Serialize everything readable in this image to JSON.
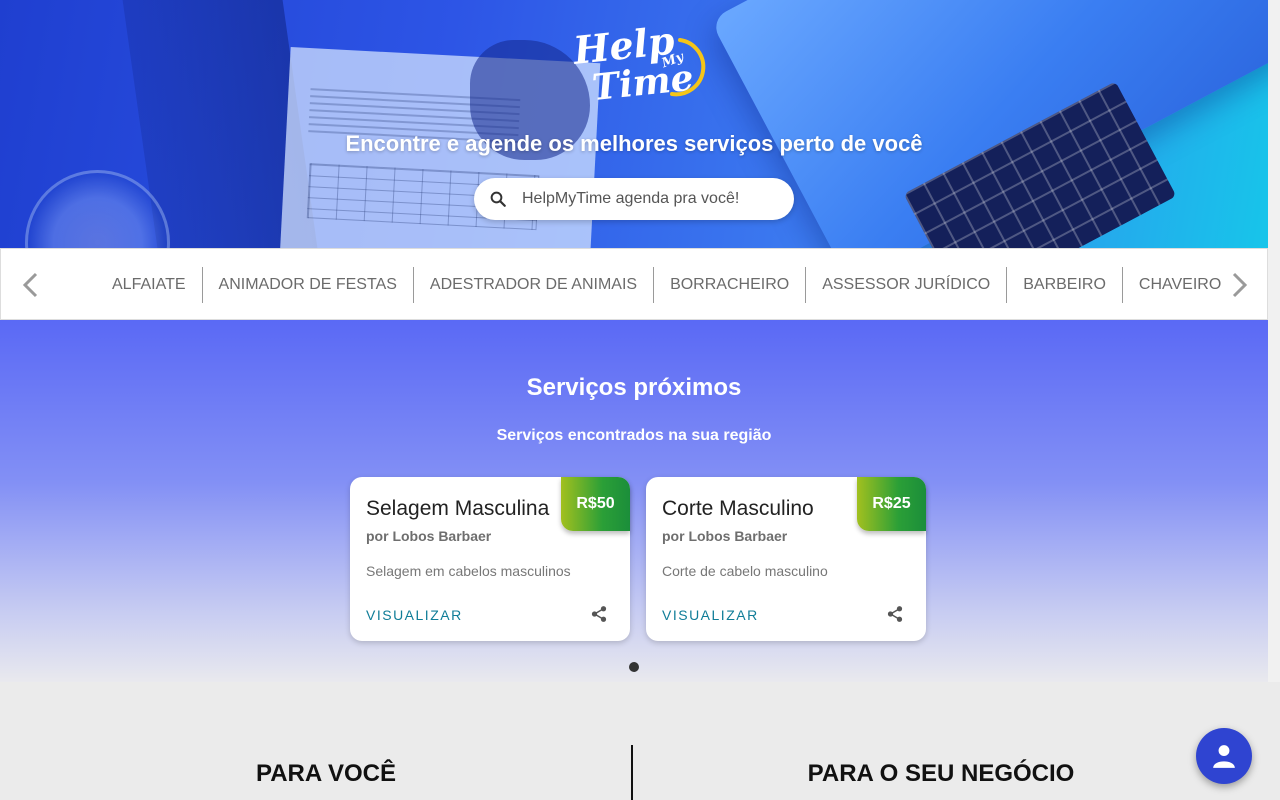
{
  "brand": {
    "logo_text_help": "Help",
    "logo_text_my": "My",
    "logo_text_time": "Time"
  },
  "hero": {
    "title": "Encontre e agende os melhores serviços perto de você",
    "search_placeholder": "HelpMyTime agenda pra você!"
  },
  "categories": [
    "ALFAIATE",
    "ANIMADOR DE FESTAS",
    "ADESTRADOR DE ANIMAIS",
    "BORRACHEIRO",
    "ASSESSOR JURÍDICO",
    "BARBEIRO",
    "CHAVEIRO"
  ],
  "services": {
    "title": "Serviços próximos",
    "subtitle": "Serviços encontrados na sua região",
    "cards": [
      {
        "name": "Selagem Masculina",
        "provider": "por Lobos Barbaer",
        "description": "Selagem em cabelos masculinos",
        "price": "R$50",
        "action": "VISUALIZAR"
      },
      {
        "name": "Corte Masculino",
        "provider": "por Lobos Barbaer",
        "description": "Corte de cabelo masculino",
        "price": "R$25",
        "action": "VISUALIZAR"
      }
    ]
  },
  "sections": {
    "for_you": "PARA VOCÊ",
    "for_business": "PARA O SEU NEGÓCIO"
  },
  "icons": {
    "search": "search-icon",
    "prev": "chevron-left-icon",
    "next": "chevron-right-icon",
    "share": "share-icon",
    "user": "user-icon"
  },
  "colors": {
    "hero_blue": "#2d55e6",
    "accent_teal": "#107d98",
    "price_green": "#2b9f37",
    "fab_blue": "#2f44d1"
  }
}
